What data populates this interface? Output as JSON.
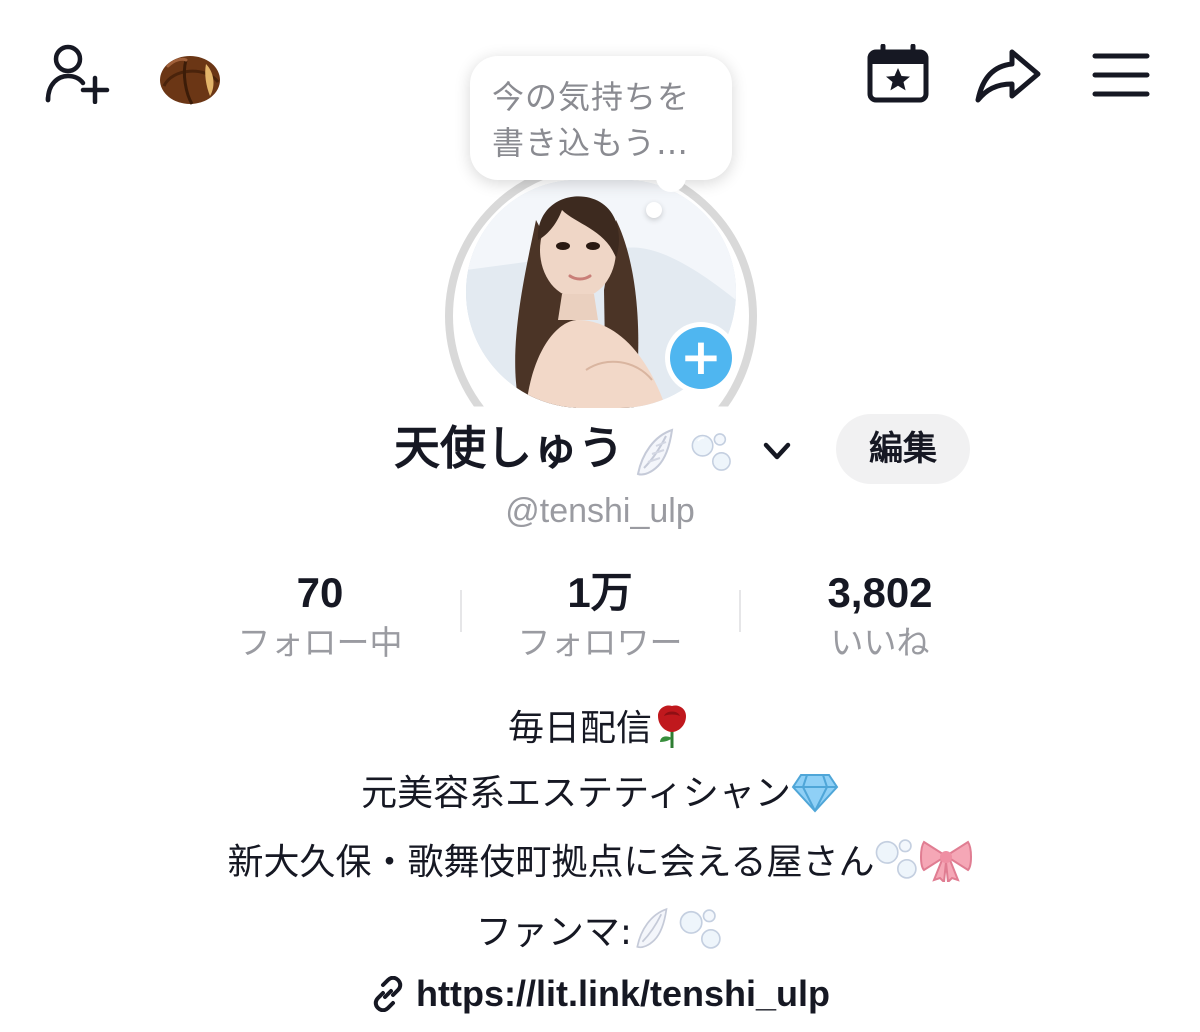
{
  "topbar": {
    "icons": [
      "add-user-icon",
      "chestnut-icon",
      "calendar-star-icon",
      "share-icon",
      "menu-icon"
    ]
  },
  "bubble": {
    "line1": "今の気持ちを",
    "line2": "書き込もう…"
  },
  "profile": {
    "name": "天使しゅう",
    "name_emojis": [
      "wing-emoji",
      "bubbles-emoji"
    ],
    "handle": "@tenshi_ulp",
    "edit_label": "編集"
  },
  "stats": [
    {
      "value": "70",
      "label": "フォロー中"
    },
    {
      "value": "1万",
      "label": "フォロワー"
    },
    {
      "value": "3,802",
      "label": "いいね"
    }
  ],
  "bio": {
    "line1": "毎日配信",
    "line2": "元美容系エステティシャン",
    "line3": "新大久保・歌舞伎町拠点に会える屋さん",
    "line4": "ファンマ:",
    "emojis": [
      "rose-emoji",
      "gem-emoji",
      "bubbles-emoji",
      "ribbon-emoji",
      "wing-emoji"
    ]
  },
  "link": {
    "url": "https://lit.link/tenshi_ulp"
  },
  "colors": {
    "text": "#161823",
    "secondary": "#9a9ba1",
    "plus_badge": "#4fb6f0",
    "edit_bg": "#f1f1f2"
  }
}
